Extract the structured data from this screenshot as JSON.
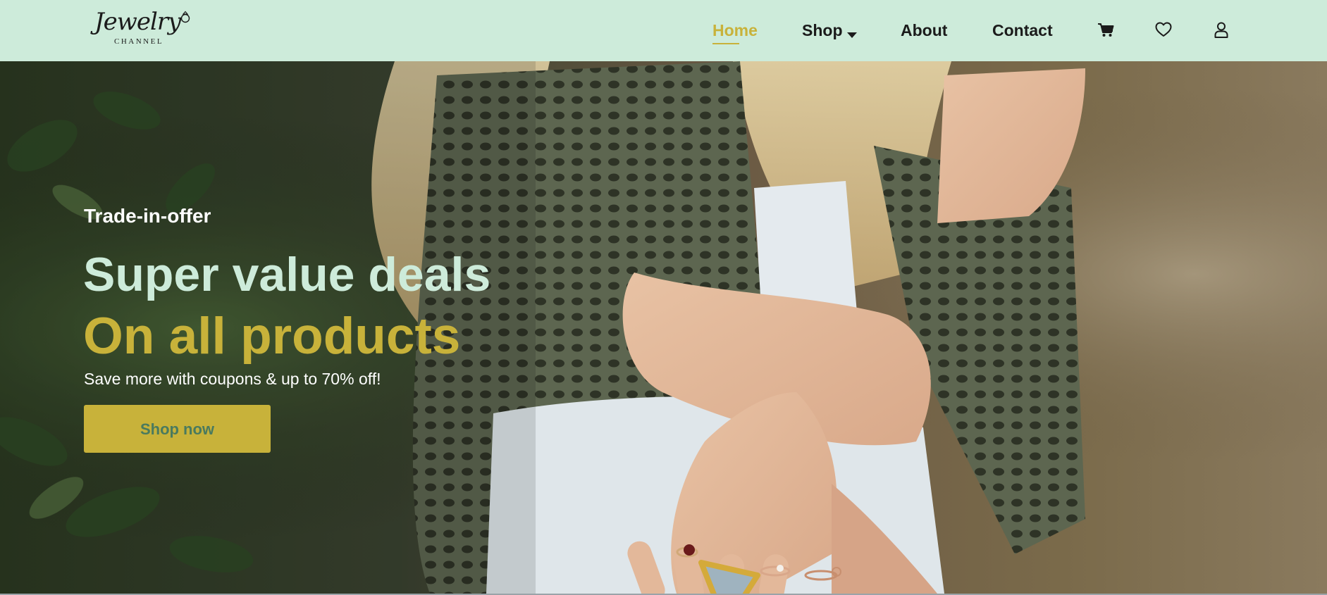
{
  "brand": {
    "logo_script": "Jewelry",
    "logo_sub": "CHANNEL"
  },
  "nav": {
    "items": [
      {
        "label": "Home",
        "active": true
      },
      {
        "label": "Shop",
        "has_dropdown": true
      },
      {
        "label": "About"
      },
      {
        "label": "Contact"
      }
    ],
    "icons": [
      "cart-icon",
      "heart-icon",
      "user-icon"
    ]
  },
  "hero": {
    "eyebrow": "Trade-in-offer",
    "headline_line1": "Super value deals",
    "headline_line2": "On all products",
    "subtext": "Save more with coupons & up to 70% off!",
    "cta_label": "Shop now",
    "image_semantic": "woman-with-rings-hero-photo"
  },
  "colors": {
    "header_bg": "#cdebda",
    "accent_gold": "#c8b23a",
    "mint": "#cdebda",
    "cta_text": "#4a7a5e",
    "dark_text": "#1b1b1b"
  }
}
